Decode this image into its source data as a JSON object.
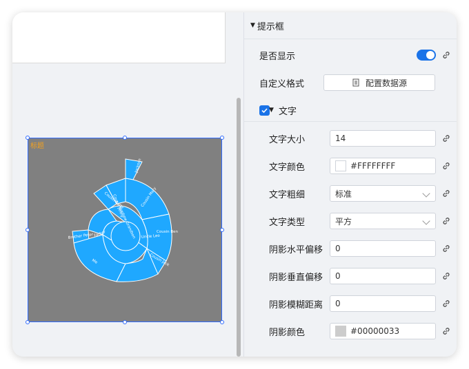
{
  "canvas": {
    "widget_title": "标题",
    "chart_labels": [
      "Grandpa",
      "Uncle Leo",
      "Cousin Jack",
      "Cousin Mary",
      "Jackson",
      "Cousin Ben",
      "Uncle Nephew",
      "Cousin Betty",
      "Father",
      "Brother Peter",
      "Me",
      "Nephew Grandson",
      "Cousin Jenny"
    ]
  },
  "panel": {
    "section_title": "提示框",
    "show_label": "是否显示",
    "show_enabled": true,
    "custom_format_label": "自定义格式",
    "data_source_button": "配置数据源",
    "text_section_label": "文字",
    "text_enabled": true,
    "fields": {
      "font_size_label": "文字大小",
      "font_size_value": "14",
      "font_color_label": "文字颜色",
      "font_color_value": "#FFFFFFFF",
      "font_weight_label": "文字粗细",
      "font_weight_value": "标准",
      "font_type_label": "文字类型",
      "font_type_value": "平方",
      "shadow_x_label": "阴影水平偏移",
      "shadow_x_value": "0",
      "shadow_y_label": "阴影垂直偏移",
      "shadow_y_value": "0",
      "shadow_blur_label": "阴影模糊距离",
      "shadow_blur_value": "0",
      "shadow_color_label": "阴影颜色",
      "shadow_color_value": "#00000033"
    }
  },
  "colors": {
    "accent": "#1a73e8",
    "sunburst_fill": "#1fa8ff",
    "widget_bg": "#808080",
    "title_color": "#f0a020"
  }
}
